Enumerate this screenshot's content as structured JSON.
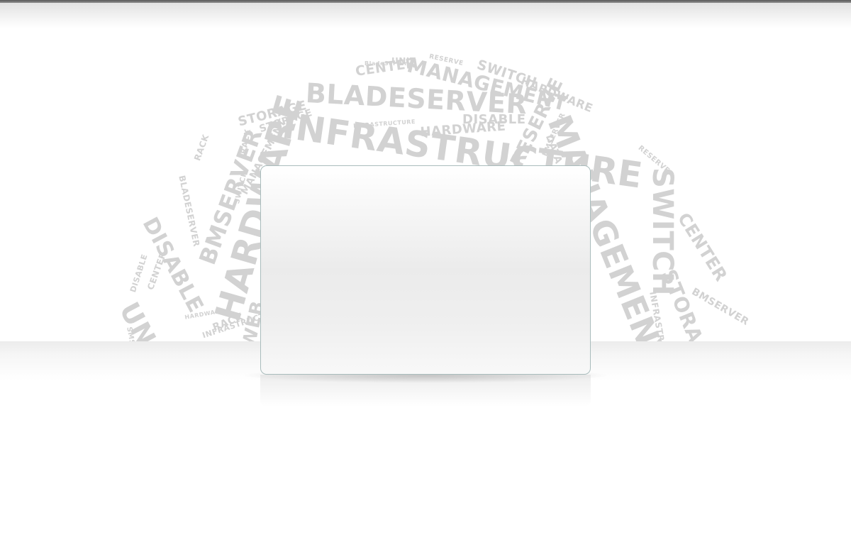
{
  "background": {
    "top_bar_color": "#5a5a5a",
    "cloud_word_color": "#d2d2d2",
    "panel_border_color": "#a9bcbc",
    "word_cloud": {
      "words": [
        "UNIT",
        "RESERVE",
        "BladeServer",
        "CENTER",
        "MANAGEMENT",
        "SWITCH",
        "HARDWARE",
        "BLADESERVER",
        "INFRASTRUCTURE",
        "STORAGE",
        "RACK",
        "DISABLE",
        "BMSERVER",
        "MANAGEMENT",
        "SWITCH",
        "HARDWARE",
        "DATA",
        "CENTER",
        "STORAGE",
        "INFRASTRUCTURE",
        "DISABLE",
        "BLADESERVER",
        "BMSERVER",
        "RACK",
        "HARDWARE",
        "RESERVE",
        "UNIT",
        "CENTER",
        "DISABLE",
        "HARDWARE",
        "RACK",
        "INFRASTRUCTURE",
        "WEB",
        "SMS",
        "STORAGE",
        "INFRASTRUCTURE",
        "RESERVE",
        "BMSERVER",
        "SWITCH",
        "MANAGEMENT"
      ]
    }
  },
  "panel": {
    "content": ""
  }
}
